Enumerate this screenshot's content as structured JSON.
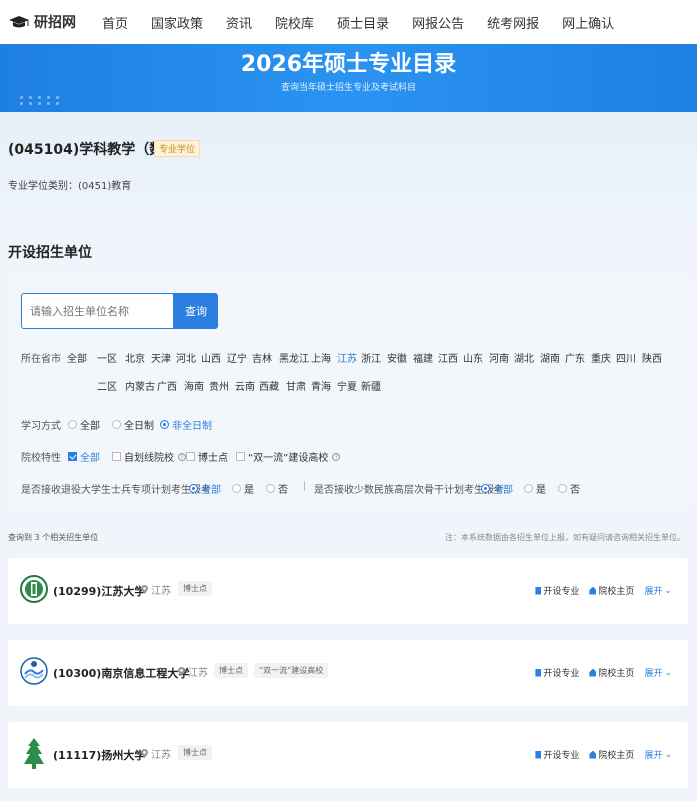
{
  "nav": {
    "logo_text": "研招网",
    "items": [
      "首页",
      "国家政策",
      "资讯",
      "院校库",
      "硕士目录",
      "网报公告",
      "统考网报",
      "网上确认"
    ]
  },
  "banner": {
    "title": "2026年硕士专业目录",
    "subtitle": "查询当年硕士招生专业及考试科目"
  },
  "major": {
    "title": "(045104)学科教学（数学）",
    "tag": "专业学位",
    "category": "专业学位类别：(0451)教育"
  },
  "section_title": "开设招生单位",
  "search": {
    "placeholder": "请输入招生单位名称",
    "button": "查询"
  },
  "filters": {
    "province_label": "所在省市",
    "province_row1": [
      "全部",
      "一区",
      "北京",
      "天津",
      "河北",
      "山西",
      "辽宁",
      "吉林",
      "黑龙江",
      "上海",
      "江苏",
      "浙江",
      "安徽",
      "福建",
      "江西",
      "山东",
      "河南",
      "湖北",
      "湖南",
      "广东",
      "重庆",
      "四川",
      "陕西"
    ],
    "province_row2": [
      "二区",
      "内蒙古",
      "广西",
      "海南",
      "贵州",
      "云南",
      "西藏",
      "甘肃",
      "青海",
      "宁夏",
      "新疆"
    ],
    "province_selected": "江苏",
    "study_label": "学习方式",
    "study_options": [
      "全部",
      "全日制",
      "非全日制"
    ],
    "study_selected": "非全日制",
    "feature_label": "院校特性",
    "feature_options": [
      "全部",
      "自划线院校",
      "博士点",
      "“双一流”建设高校"
    ],
    "soldier_label": "是否接收退役大学生士兵专项计划考生报考",
    "soldier_options": [
      "全部",
      "是",
      "否"
    ],
    "minority_label": "是否接收少数民族高层次骨干计划考生报考",
    "minority_options": [
      "全部",
      "是",
      "否"
    ]
  },
  "results": {
    "count_text": "查询到 3 个相关招生单位",
    "note": "注：本系统数据由各招生单位上报，如有疑问请咨询相关招生单位。"
  },
  "actions": {
    "majors": "开设专业",
    "homepage": "院校主页",
    "expand": "展开"
  },
  "universities": [
    {
      "name": "(10299)江苏大学",
      "location": "江苏",
      "tags": [
        "博士点"
      ]
    },
    {
      "name": "(10300)南京信息工程大学",
      "location": "江苏",
      "tags": [
        "博士点",
        "“双一流”建设高校"
      ]
    },
    {
      "name": "(11117)扬州大学",
      "location": "江苏",
      "tags": [
        "博士点"
      ]
    }
  ],
  "colors": {
    "primary": "#2b7fe0",
    "banner": "#2a93f2",
    "tag_gold": "#c98b1f"
  }
}
